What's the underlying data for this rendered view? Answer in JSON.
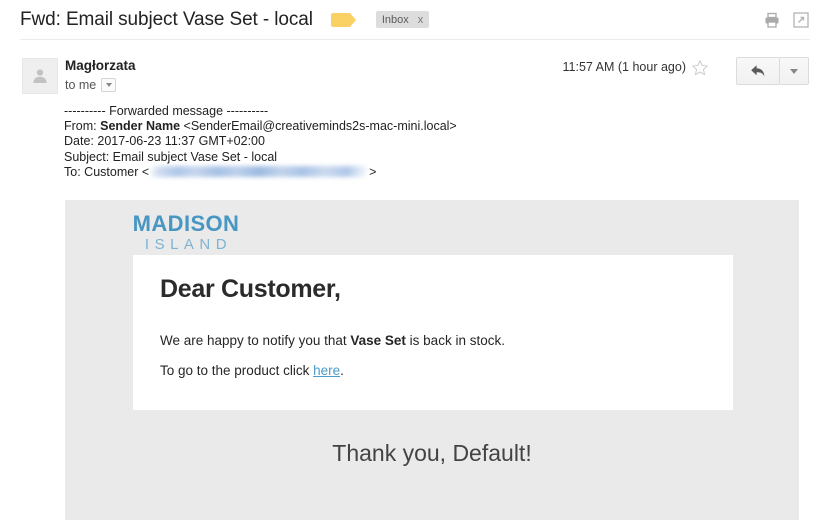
{
  "header": {
    "subject": "Fwd: Email subject Vase Set - local",
    "label_tag_color": "#fad165",
    "label_tag_name": "label-tag-icon",
    "inbox_chip": "Inbox",
    "inbox_chip_close": "x",
    "print_icon": "print-icon",
    "popout_icon": "open-in-new-window-icon"
  },
  "message": {
    "sender": "Magłorzata",
    "recipient": "to me",
    "recipient_caret_icon": "chevron-down-icon",
    "timestamp": "11:57 AM (1 hour ago)",
    "star_icon": "star-icon",
    "reply_icon": "reply-arrow-icon",
    "more_icon": "chevron-down-icon",
    "avatar_icon": "person-avatar-icon"
  },
  "forwarded": {
    "separator": "---------- Forwarded message ----------",
    "from_label": "From:",
    "from_name": "Sender Name",
    "from_email": "<SenderEmail@creativeminds2s-mac-mini.local>",
    "date_label": "Date:",
    "date_value": "2017-06-23 11:37 GMT+02:00",
    "subject_label": "Subject:",
    "subject_value": "Email subject Vase Set - local",
    "to_label": "To:",
    "to_name": "Customer",
    "to_open_bracket": "<",
    "to_close_bracket": ">",
    "to_email_redacted": ""
  },
  "email_body": {
    "brand_top": "MADISON",
    "brand_bottom": "ISLAND",
    "brand_top_color": "#4896c2",
    "brand_bottom_color": "#7cb4d3",
    "greeting": "Dear Customer,",
    "line1_part1": "We are happy to notify you that ",
    "line1_bold": "Vase Set",
    "line1_part2": " is back in stock.",
    "line2_part1": "To go to the product click ",
    "line2_link": "here",
    "line2_part2": ".",
    "link_color": "#4b9cc9",
    "footer": "Thank you, Default!",
    "canvas_color": "#eaeaea"
  }
}
